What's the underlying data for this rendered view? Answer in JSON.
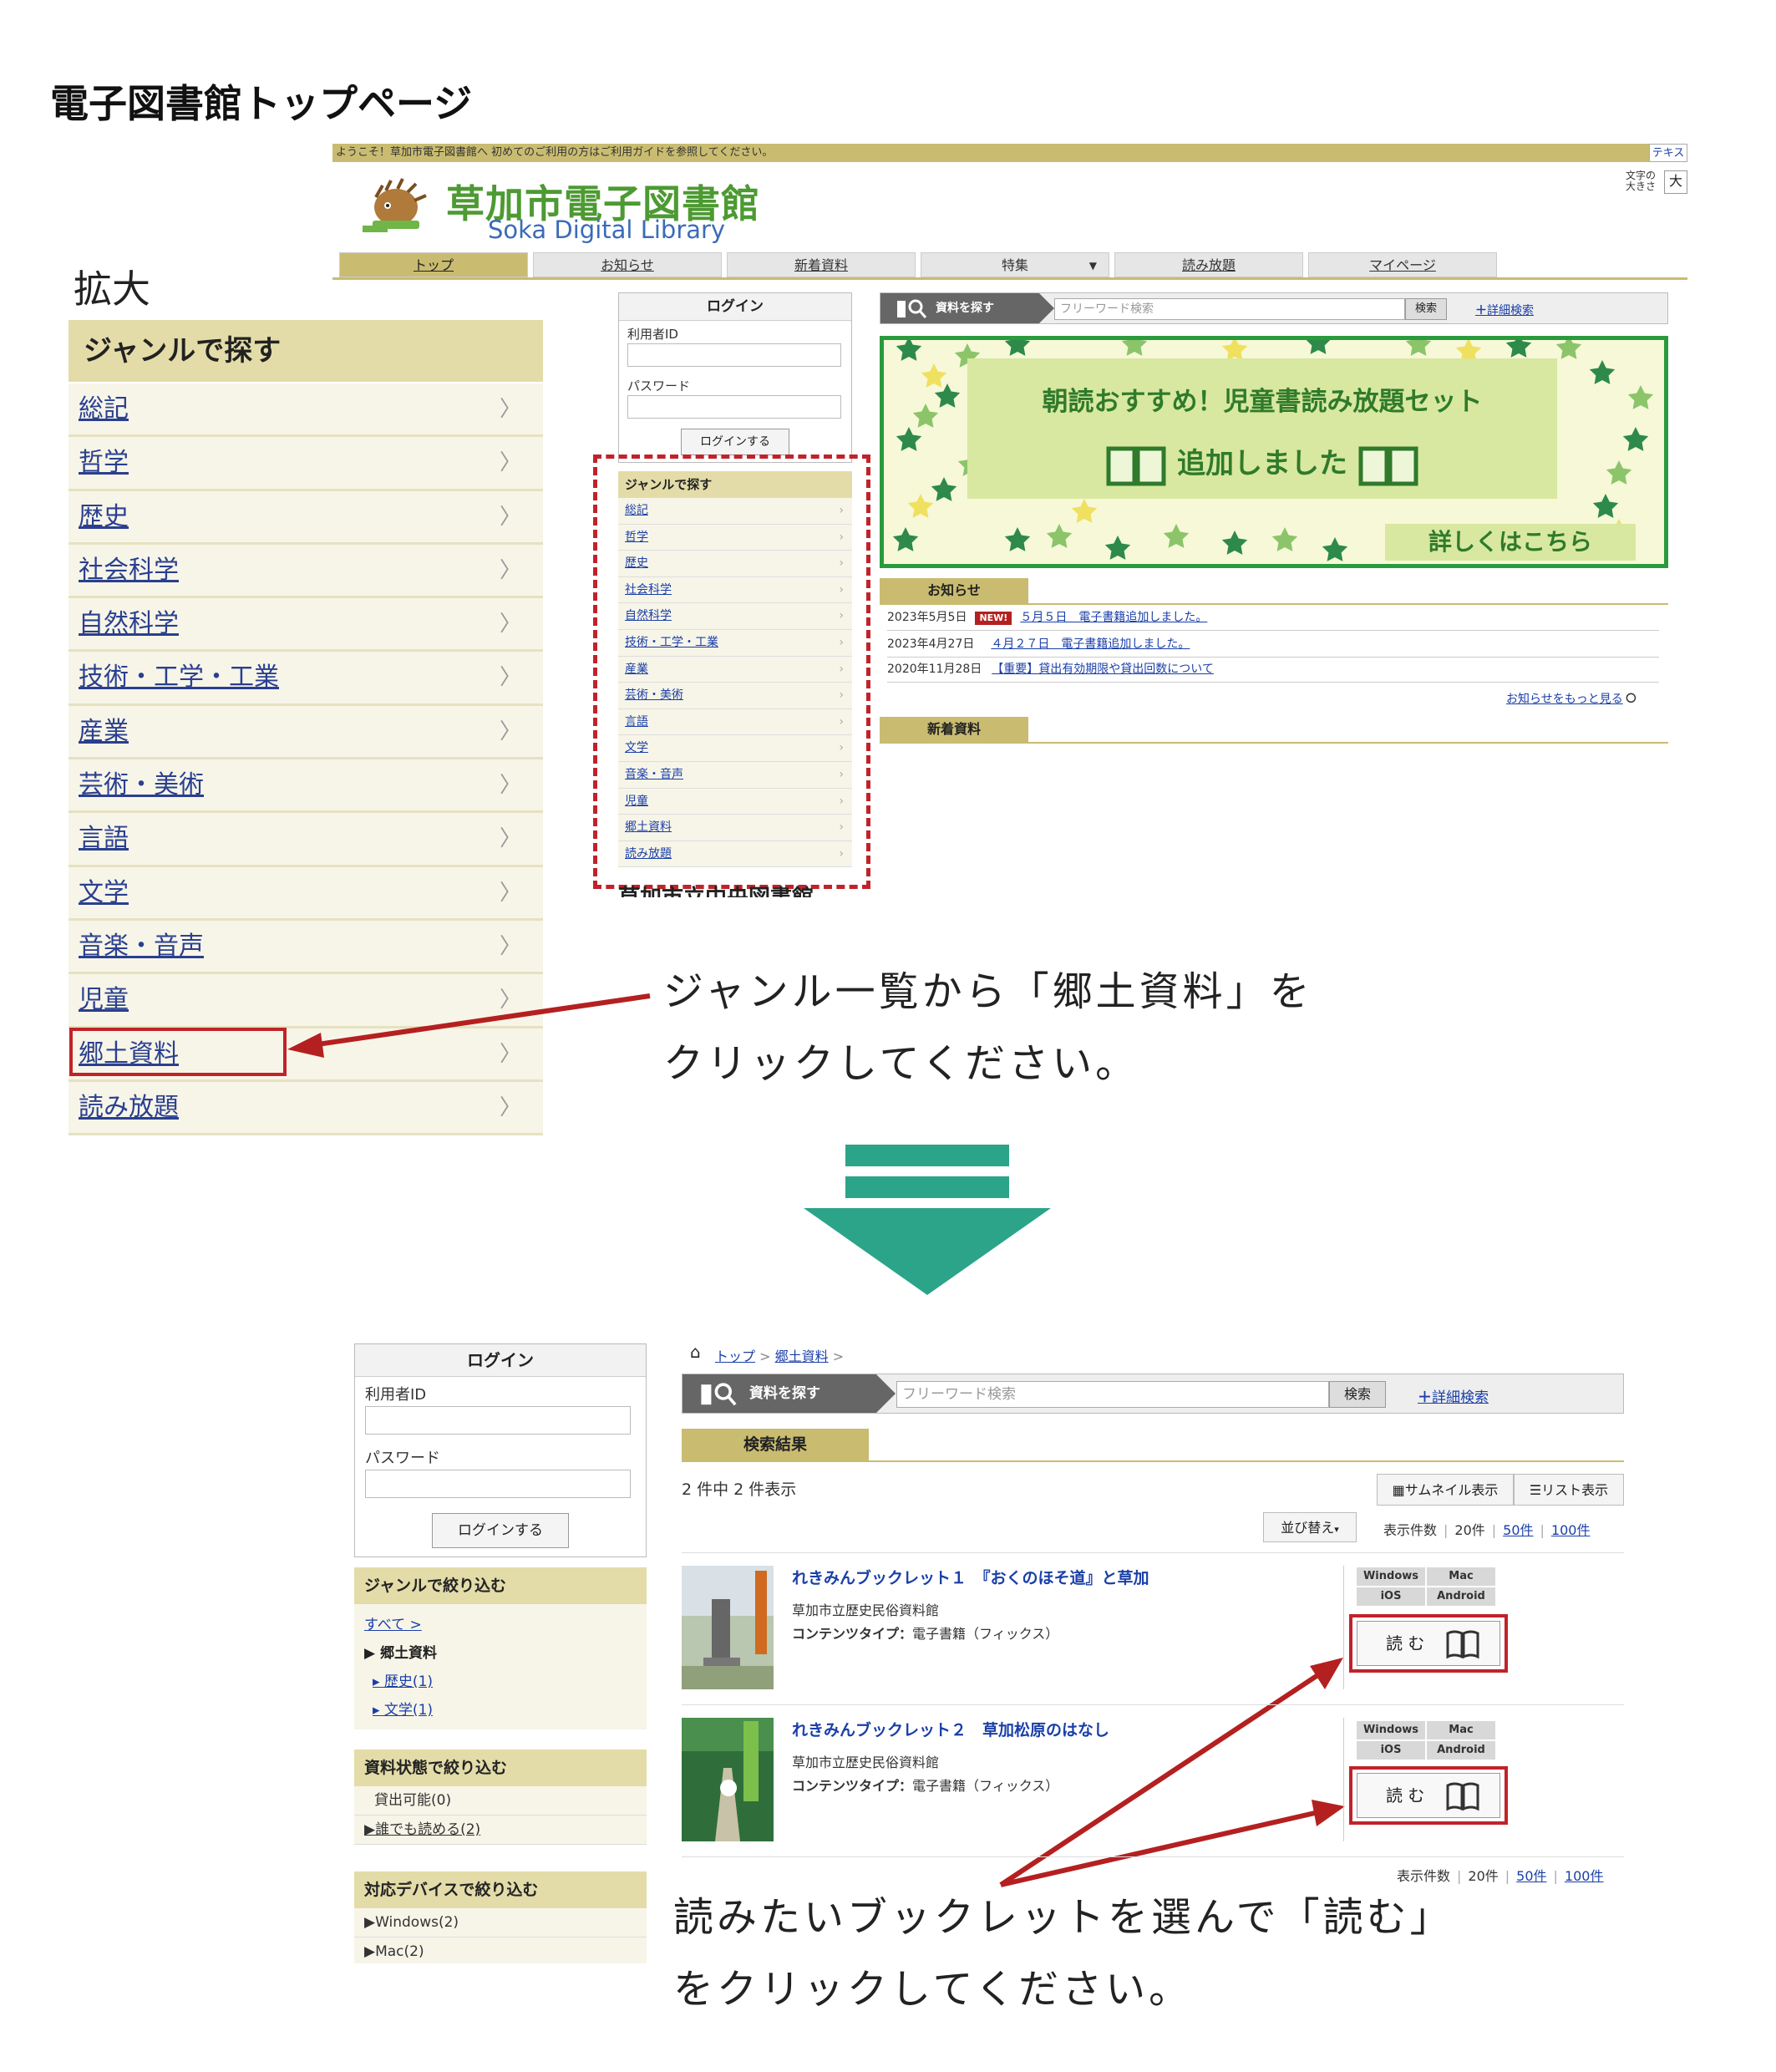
{
  "page_title": "電子図書館トップページ",
  "zoom_label": "拡大",
  "colors": {
    "accent_gold": "#c9bc71",
    "genre_bg": "#e3dca8",
    "highlight_red": "#c0232a",
    "arrow_teal": "#2ba48a",
    "logo_green": "#4d9a33"
  },
  "top": {
    "welcome": "ようこそ！草加市電子図書館へ 初めてのご利用の方はご利用ガイドを参照してください。",
    "text_button": "テキス",
    "font_size_label": "文字の大きさ",
    "font_size_big": "大",
    "logo_ja": "草加市電子図書館",
    "logo_en": "Soka Digital Library",
    "nav": [
      "トップ",
      "お知らせ",
      "新着資料",
      "特集",
      "読み放題",
      "マイページ"
    ],
    "nav_dropdown_icon": "chevron-down-icon",
    "login": {
      "title": "ログイン",
      "user_id_label": "利用者ID",
      "password_label": "パスワード",
      "button": "ログインする"
    },
    "genre_title": "ジャンルで探す",
    "genres": [
      "総記",
      "哲学",
      "歴史",
      "社会科学",
      "自然科学",
      "技術・工学・工業",
      "産業",
      "芸術・美術",
      "言語",
      "文学",
      "音楽・音声",
      "児童",
      "郷土資料",
      "読み放題"
    ],
    "library_footer": "草加市立中央図書館",
    "search": {
      "tag": "資料を探す",
      "placeholder": "フリーワード検索",
      "button": "検索",
      "advanced": "詳細検索"
    },
    "banner": {
      "line1": "朝読おすすめ！児童書読み放題セット",
      "line2": "追加しました",
      "more": "詳しくはこちら"
    },
    "news_title": "お知らせ",
    "news": [
      {
        "date": "2023年5月5日",
        "badge": "NEW!",
        "text": "５月５日　電子書籍追加しました。"
      },
      {
        "date": "2023年4月27日",
        "badge": "",
        "text": "４月２７日　電子書籍追加しました。"
      },
      {
        "date": "2020年11月28日",
        "badge": "",
        "text": "【重要】貸出有効期限や貸出回数について"
      }
    ],
    "news_more": "お知らせをもっと見る",
    "new_arrivals_title": "新着資料"
  },
  "instruction1": {
    "line1": "ジャンル一覧から「郷土資料」を",
    "line2": "クリックしてください。"
  },
  "bottom": {
    "breadcrumb": {
      "home": "トップ",
      "current": "郷土資料",
      "sep": ">"
    },
    "login": {
      "title": "ログイン",
      "user_id_label": "利用者ID",
      "password_label": "パスワード",
      "button": "ログインする"
    },
    "genre_filter": {
      "title": "ジャンルで絞り込む",
      "all": "すべて >",
      "current": "▶ 郷土資料",
      "children": [
        "▸ 歴史(1)",
        "▸ 文学(1)"
      ]
    },
    "status_filter": {
      "title": "資料状態で絞り込む",
      "items": [
        "貸出可能(0)",
        "▶誰でも読める(2)"
      ]
    },
    "device_filter": {
      "title": "対応デバイスで絞り込む",
      "items": [
        "▶Windows(2)",
        "▶Mac(2)"
      ]
    },
    "search": {
      "tag": "資料を探す",
      "placeholder": "フリーワード検索",
      "button": "検索",
      "advanced": "詳細検索"
    },
    "results_tab": "検索結果",
    "count": "2 件中 2 件表示",
    "view_thumb": "サムネイル表示",
    "view_list": "リスト表示",
    "sort": "並び替え",
    "per_page": {
      "label": "表示件数",
      "opt20": "20件",
      "opt50": "50件",
      "opt100": "100件"
    },
    "content_type_label": "コンテンツタイプ：",
    "devices": [
      "Windows",
      "Mac",
      "iOS",
      "Android"
    ],
    "read_label": "読 む",
    "books": [
      {
        "title": "れきみんブックレット１　『おくのほそ道』と草加",
        "publisher": "草加市立歴史民俗資料館",
        "content_type": "電子書籍（フィックス）"
      },
      {
        "title": "れきみんブックレット２　草加松原のはなし",
        "publisher": "草加市立歴史民俗資料館",
        "content_type": "電子書籍（フィックス）"
      }
    ]
  },
  "instruction2": {
    "line1": "読みたいブックレットを選んで「読む」",
    "line2": "をクリックしてください。"
  }
}
